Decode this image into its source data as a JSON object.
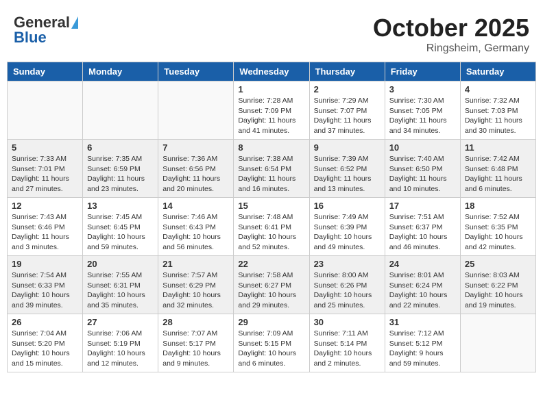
{
  "header": {
    "logo_general": "General",
    "logo_blue": "Blue",
    "title": "October 2025",
    "subtitle": "Ringsheim, Germany"
  },
  "days_of_week": [
    "Sunday",
    "Monday",
    "Tuesday",
    "Wednesday",
    "Thursday",
    "Friday",
    "Saturday"
  ],
  "weeks": [
    {
      "shaded": false,
      "days": [
        {
          "num": "",
          "info": ""
        },
        {
          "num": "",
          "info": ""
        },
        {
          "num": "",
          "info": ""
        },
        {
          "num": "1",
          "info": "Sunrise: 7:28 AM\nSunset: 7:09 PM\nDaylight: 11 hours\nand 41 minutes."
        },
        {
          "num": "2",
          "info": "Sunrise: 7:29 AM\nSunset: 7:07 PM\nDaylight: 11 hours\nand 37 minutes."
        },
        {
          "num": "3",
          "info": "Sunrise: 7:30 AM\nSunset: 7:05 PM\nDaylight: 11 hours\nand 34 minutes."
        },
        {
          "num": "4",
          "info": "Sunrise: 7:32 AM\nSunset: 7:03 PM\nDaylight: 11 hours\nand 30 minutes."
        }
      ]
    },
    {
      "shaded": true,
      "days": [
        {
          "num": "5",
          "info": "Sunrise: 7:33 AM\nSunset: 7:01 PM\nDaylight: 11 hours\nand 27 minutes."
        },
        {
          "num": "6",
          "info": "Sunrise: 7:35 AM\nSunset: 6:59 PM\nDaylight: 11 hours\nand 23 minutes."
        },
        {
          "num": "7",
          "info": "Sunrise: 7:36 AM\nSunset: 6:56 PM\nDaylight: 11 hours\nand 20 minutes."
        },
        {
          "num": "8",
          "info": "Sunrise: 7:38 AM\nSunset: 6:54 PM\nDaylight: 11 hours\nand 16 minutes."
        },
        {
          "num": "9",
          "info": "Sunrise: 7:39 AM\nSunset: 6:52 PM\nDaylight: 11 hours\nand 13 minutes."
        },
        {
          "num": "10",
          "info": "Sunrise: 7:40 AM\nSunset: 6:50 PM\nDaylight: 11 hours\nand 10 minutes."
        },
        {
          "num": "11",
          "info": "Sunrise: 7:42 AM\nSunset: 6:48 PM\nDaylight: 11 hours\nand 6 minutes."
        }
      ]
    },
    {
      "shaded": false,
      "days": [
        {
          "num": "12",
          "info": "Sunrise: 7:43 AM\nSunset: 6:46 PM\nDaylight: 11 hours\nand 3 minutes."
        },
        {
          "num": "13",
          "info": "Sunrise: 7:45 AM\nSunset: 6:45 PM\nDaylight: 10 hours\nand 59 minutes."
        },
        {
          "num": "14",
          "info": "Sunrise: 7:46 AM\nSunset: 6:43 PM\nDaylight: 10 hours\nand 56 minutes."
        },
        {
          "num": "15",
          "info": "Sunrise: 7:48 AM\nSunset: 6:41 PM\nDaylight: 10 hours\nand 52 minutes."
        },
        {
          "num": "16",
          "info": "Sunrise: 7:49 AM\nSunset: 6:39 PM\nDaylight: 10 hours\nand 49 minutes."
        },
        {
          "num": "17",
          "info": "Sunrise: 7:51 AM\nSunset: 6:37 PM\nDaylight: 10 hours\nand 46 minutes."
        },
        {
          "num": "18",
          "info": "Sunrise: 7:52 AM\nSunset: 6:35 PM\nDaylight: 10 hours\nand 42 minutes."
        }
      ]
    },
    {
      "shaded": true,
      "days": [
        {
          "num": "19",
          "info": "Sunrise: 7:54 AM\nSunset: 6:33 PM\nDaylight: 10 hours\nand 39 minutes."
        },
        {
          "num": "20",
          "info": "Sunrise: 7:55 AM\nSunset: 6:31 PM\nDaylight: 10 hours\nand 35 minutes."
        },
        {
          "num": "21",
          "info": "Sunrise: 7:57 AM\nSunset: 6:29 PM\nDaylight: 10 hours\nand 32 minutes."
        },
        {
          "num": "22",
          "info": "Sunrise: 7:58 AM\nSunset: 6:27 PM\nDaylight: 10 hours\nand 29 minutes."
        },
        {
          "num": "23",
          "info": "Sunrise: 8:00 AM\nSunset: 6:26 PM\nDaylight: 10 hours\nand 25 minutes."
        },
        {
          "num": "24",
          "info": "Sunrise: 8:01 AM\nSunset: 6:24 PM\nDaylight: 10 hours\nand 22 minutes."
        },
        {
          "num": "25",
          "info": "Sunrise: 8:03 AM\nSunset: 6:22 PM\nDaylight: 10 hours\nand 19 minutes."
        }
      ]
    },
    {
      "shaded": false,
      "days": [
        {
          "num": "26",
          "info": "Sunrise: 7:04 AM\nSunset: 5:20 PM\nDaylight: 10 hours\nand 15 minutes."
        },
        {
          "num": "27",
          "info": "Sunrise: 7:06 AM\nSunset: 5:19 PM\nDaylight: 10 hours\nand 12 minutes."
        },
        {
          "num": "28",
          "info": "Sunrise: 7:07 AM\nSunset: 5:17 PM\nDaylight: 10 hours\nand 9 minutes."
        },
        {
          "num": "29",
          "info": "Sunrise: 7:09 AM\nSunset: 5:15 PM\nDaylight: 10 hours\nand 6 minutes."
        },
        {
          "num": "30",
          "info": "Sunrise: 7:11 AM\nSunset: 5:14 PM\nDaylight: 10 hours\nand 2 minutes."
        },
        {
          "num": "31",
          "info": "Sunrise: 7:12 AM\nSunset: 5:12 PM\nDaylight: 9 hours\nand 59 minutes."
        },
        {
          "num": "",
          "info": ""
        }
      ]
    }
  ]
}
